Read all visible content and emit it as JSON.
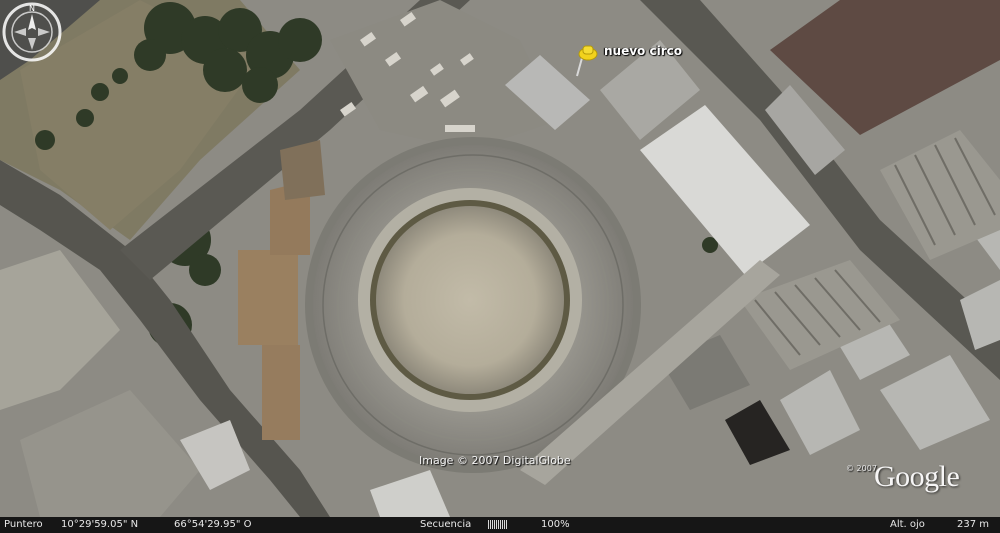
{
  "placemark": {
    "label": "nuevo circo",
    "icon": "yellow-pushpin-icon",
    "color": "#f2d21c"
  },
  "imagery_credit": "Image © 2007 DigitalGlobe",
  "branding": {
    "copyright_small": "© 2007",
    "logo_text": "Google"
  },
  "navigation": {
    "compass_north_label": "N",
    "icon": "compass-icon"
  },
  "status_bar": {
    "pointer_label": "Puntero",
    "latitude": "10°29'59.05\" N",
    "longitude": "66°54'29.95\" O",
    "streaming_label": "Secuencia",
    "streaming_bars": "||||||||||",
    "streaming_percent": "100%",
    "eye_alt_label": "Alt. ojo",
    "eye_alt_value": "237 m"
  }
}
